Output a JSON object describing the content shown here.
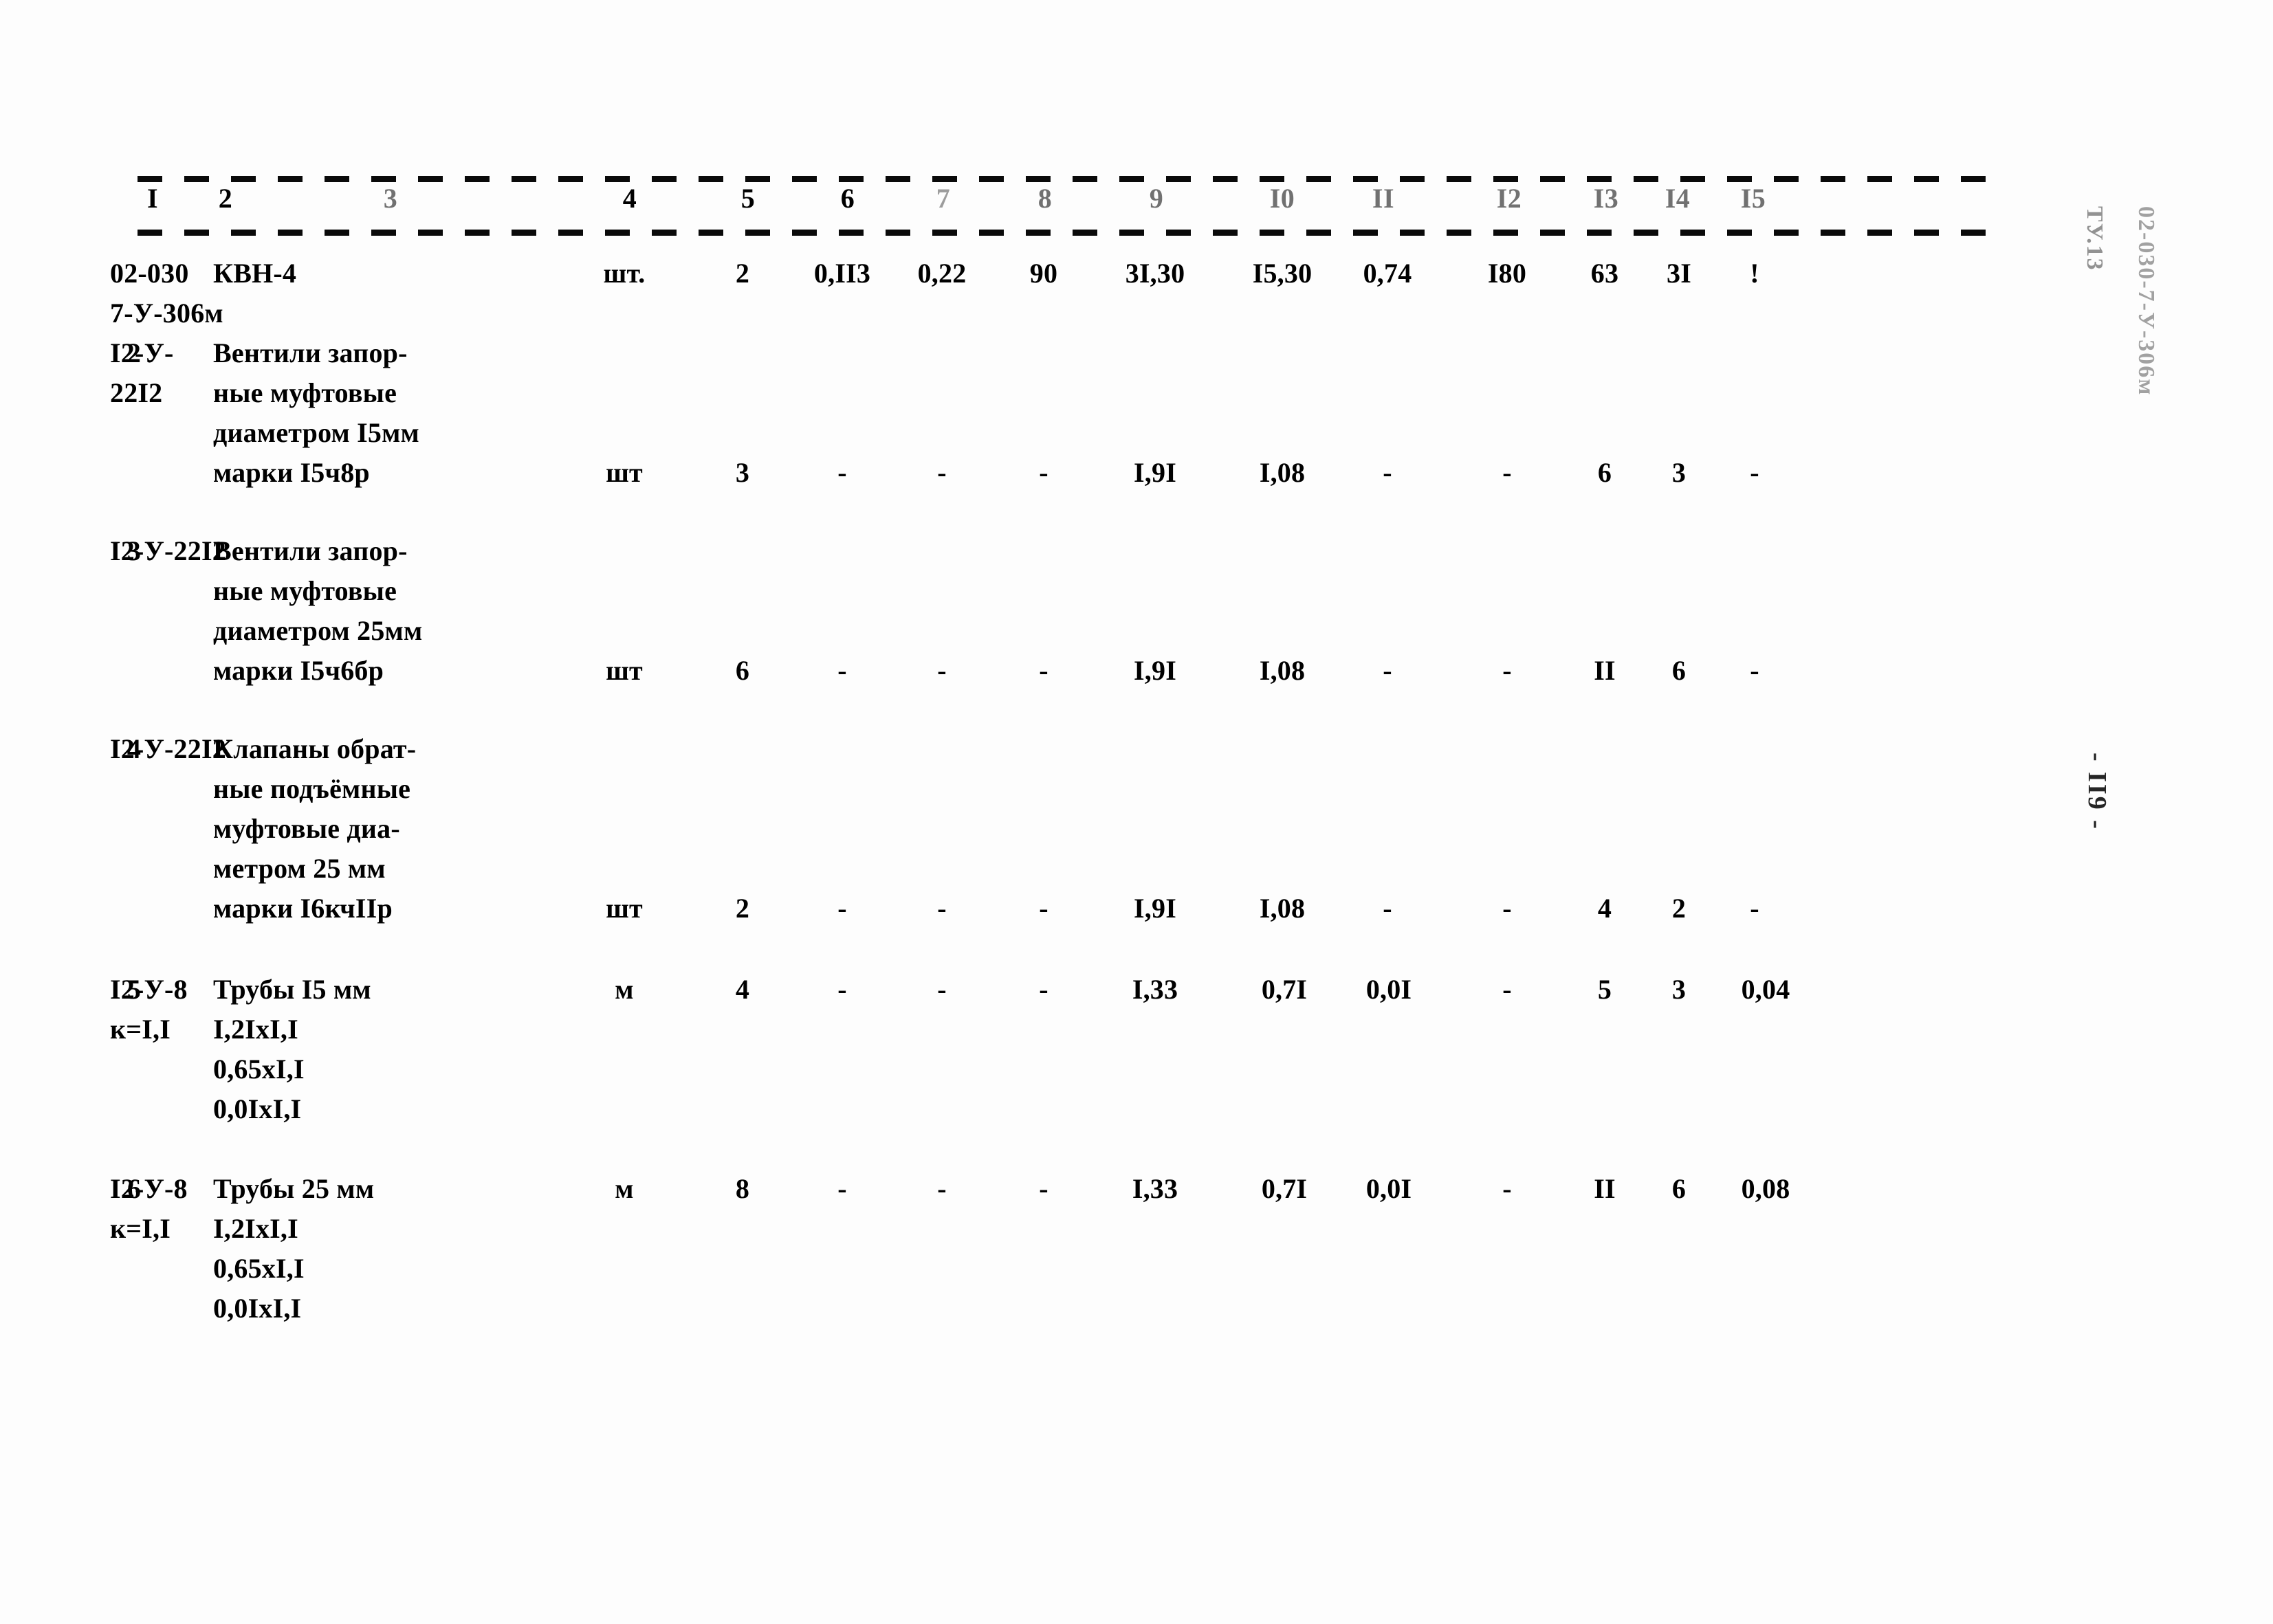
{
  "document": {
    "kind": "scanned-technical-specification-table",
    "page_number_margin": "- II9 -",
    "margin_stamp_top": "02-030-7-У-306м",
    "margin_stamp_top_secondary": "ТУ.13"
  },
  "table": {
    "column_numbers": [
      "I",
      "2",
      "3",
      "4",
      "5",
      "6",
      "7",
      "8",
      "9",
      "I0",
      "II",
      "I2",
      "I3",
      "I4",
      "I5"
    ],
    "rows": [
      {
        "num": "",
        "code": "02-030\n7-У-306м",
        "description": "КВН-4",
        "unit": "шт.",
        "c5": "2",
        "c6": "0,II3",
        "c7": "0,22",
        "c8": "90",
        "c9": "3I,30",
        "c10": "I5,30",
        "c11": "0,74",
        "c12": "I80",
        "c13": "63",
        "c14": "3I",
        "c15": "!"
      },
      {
        "num": "2",
        "code": "I2-У-\n22I2",
        "description": "Вентили запор-\nные муфтовые\nдиаметром I5мм\nмарки I5ч8р",
        "unit": "шт",
        "c5": "3",
        "c6": "-",
        "c7": "-",
        "c8": "-",
        "c9": "I,9I",
        "c10": "I,08",
        "c11": "-",
        "c12": "-",
        "c13": "6",
        "c14": "3",
        "c15": "-"
      },
      {
        "num": "3",
        "code": "I2-У-22I2",
        "description": "Вентили запор-\nные муфтовые\nдиаметром 25мм\nмарки I5ч6бр",
        "unit": "шт",
        "c5": "6",
        "c6": "-",
        "c7": "-",
        "c8": "-",
        "c9": "I,9I",
        "c10": "I,08",
        "c11": "-",
        "c12": "-",
        "c13": "II",
        "c14": "6",
        "c15": "-"
      },
      {
        "num": "4",
        "code": "I2-У-22I2",
        "description": "Клапаны обрат-\nные подъёмные\nмуфтовые диа-\nметром 25 мм\nмарки I6кчIIр",
        "unit": "шт",
        "c5": "2",
        "c6": "-",
        "c7": "-",
        "c8": "-",
        "c9": "I,9I",
        "c10": "I,08",
        "c11": "-",
        "c12": "-",
        "c13": "4",
        "c14": "2",
        "c15": "-"
      },
      {
        "num": "5",
        "code": "I2-У-8\nк=I,I",
        "description": "Трубы I5 мм\nI,2IхI,I\n0,65хI,I\n0,0IхI,I",
        "unit": "м",
        "c5": "4",
        "c6": "-",
        "c7": "-",
        "c8": "-",
        "c9": "I,33",
        "c10": "0,7I",
        "c11": "0,0I",
        "c12": "-",
        "c13": "5",
        "c14": "3",
        "c15": "0,04"
      },
      {
        "num": "6",
        "code": "I2-У-8\nк=I,I",
        "description": "Трубы 25 мм\nI,2IхI,I\n0,65хI,I\n0,0IхI,I",
        "unit": "м",
        "c5": "8",
        "c6": "-",
        "c7": "-",
        "c8": "-",
        "c9": "I,33",
        "c10": "0,7I",
        "c11": "0,0I",
        "c12": "-",
        "c13": "II",
        "c14": "6",
        "c15": "0,08"
      }
    ]
  }
}
